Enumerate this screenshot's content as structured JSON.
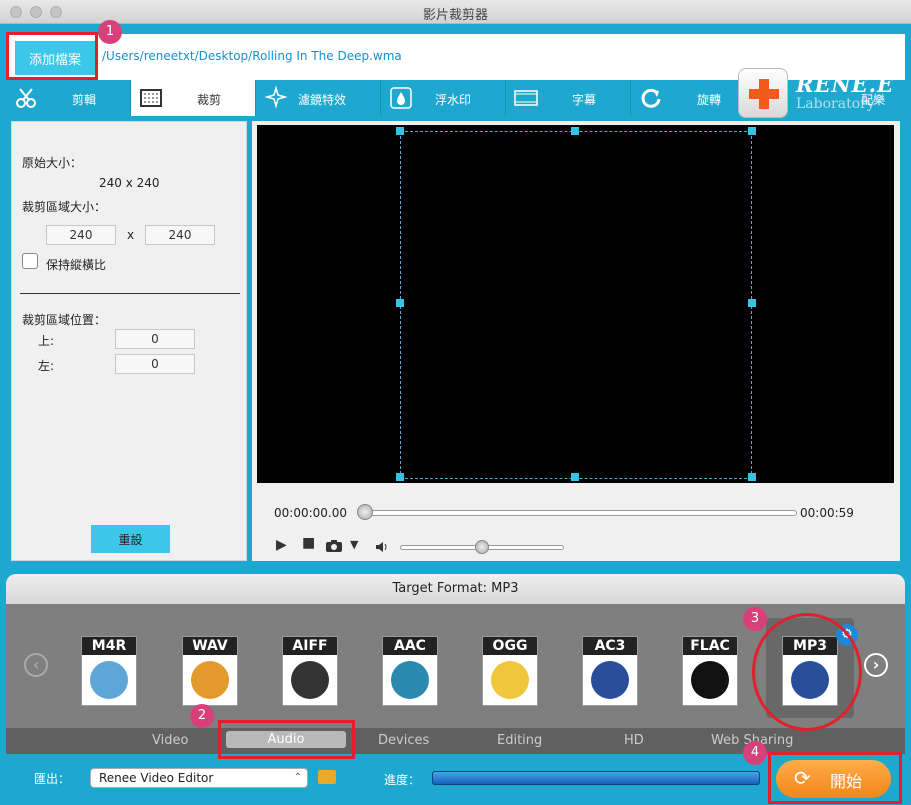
{
  "window": {
    "title": "影片裁剪器"
  },
  "file": {
    "add_label": "添加檔案",
    "path": "/Users/reneetxt/Desktop/Rolling In The Deep.wma"
  },
  "tabs": [
    {
      "label": "剪輯",
      "icon": "scissors-icon"
    },
    {
      "label": "裁剪",
      "icon": "crop-icon",
      "active": true
    },
    {
      "label": "濾鏡特效",
      "icon": "sparkle-icon"
    },
    {
      "label": "浮水印",
      "icon": "watermark-drop-icon"
    },
    {
      "label": "字幕",
      "icon": "subtitle-film-icon"
    },
    {
      "label": "旋轉",
      "icon": "rotate-icon"
    },
    {
      "label": "配樂",
      "icon": "music-icon"
    }
  ],
  "logo": {
    "text": "RENE.E",
    "sub": "Laboratory"
  },
  "crop_panel": {
    "original_size_label": "原始大小：",
    "original_size_value": "240 x 240",
    "crop_size_label": "裁剪區域大小：",
    "width": "240",
    "x_sep": "x",
    "height": "240",
    "keep_ratio_label": "保持縱橫比",
    "position_label": "裁剪區域位置：",
    "top_label": "上:",
    "top_value": "0",
    "left_label": "左:",
    "left_value": "0",
    "reset_label": "重設"
  },
  "player": {
    "time_start": "00:00:00.00",
    "time_end": "00:00:59",
    "position_fraction": 0.0,
    "volume_fraction": 0.5
  },
  "target": {
    "header": "Target Format: MP3",
    "formats": [
      "M4R",
      "WAV",
      "AIFF",
      "AAC",
      "OGG",
      "AC3",
      "FLAC",
      "MP3"
    ],
    "selected": "MP3",
    "categories": [
      "Video",
      "Audio",
      "Devices",
      "Editing",
      "HD",
      "Web Sharing"
    ],
    "active_category": "Audio"
  },
  "bottom": {
    "export_label": "匯出：",
    "export_value": "Renee Video Editor",
    "progress_label": "進度：",
    "start_label": "開始"
  },
  "annotations": [
    "1",
    "2",
    "3",
    "4"
  ],
  "colors": {
    "accent": "#1ea8cf",
    "button": "#3cc6e8",
    "start": "#f28618",
    "highlight": "#e0202c"
  }
}
